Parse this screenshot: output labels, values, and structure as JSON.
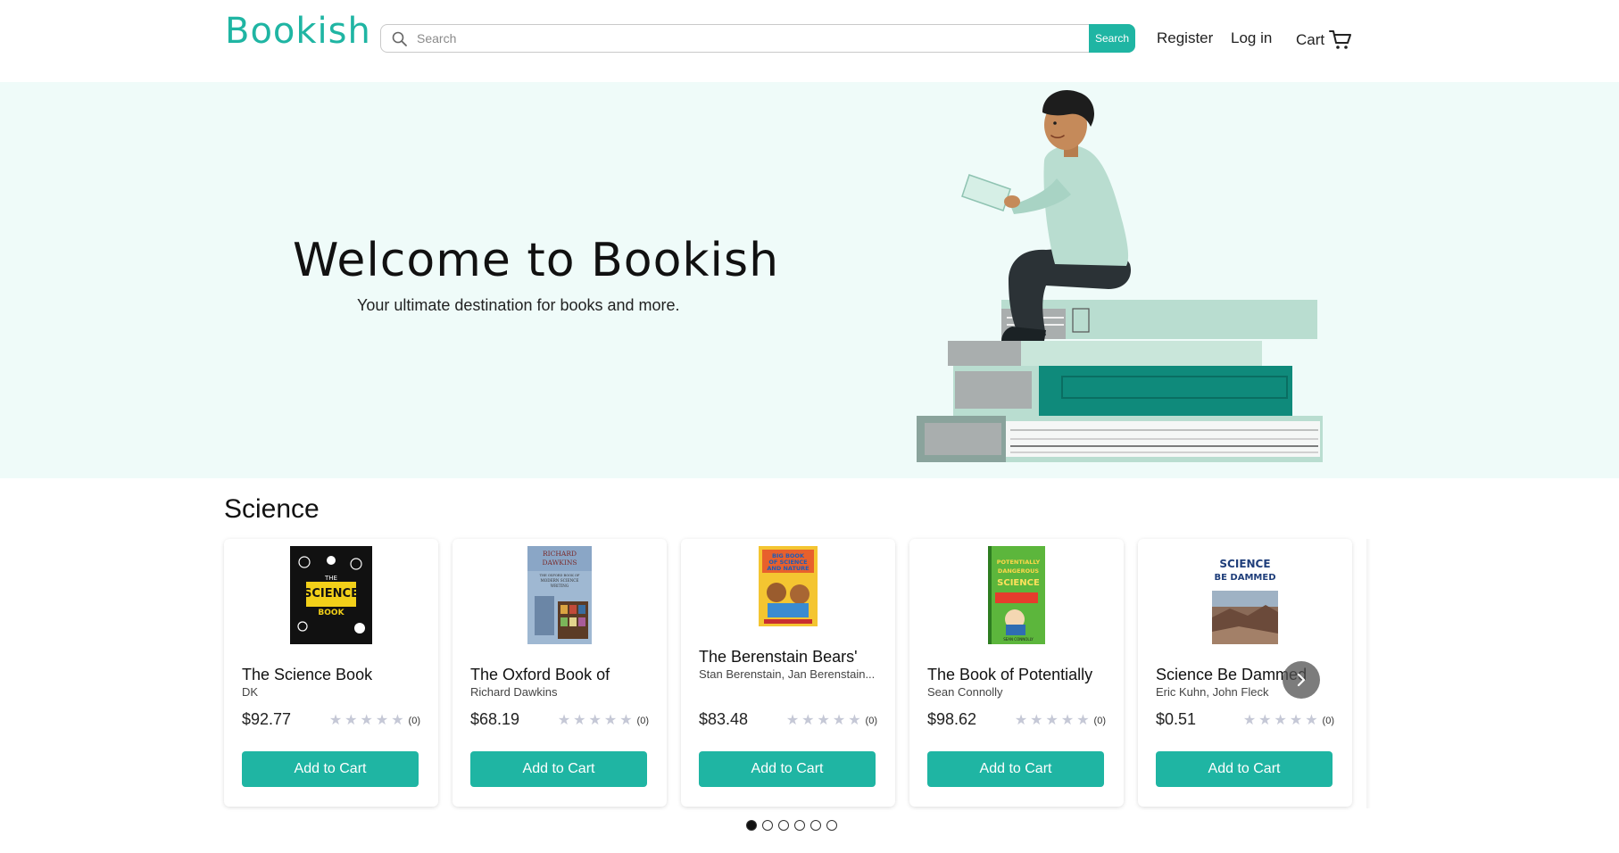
{
  "header": {
    "logo": "Bookish",
    "search_placeholder": "Search",
    "search_button": "Search",
    "register": "Register",
    "login": "Log in",
    "cart": "Cart"
  },
  "hero": {
    "title": "Welcome to Bookish",
    "subtitle": "Your ultimate destination for books and more."
  },
  "section": {
    "title": "Science"
  },
  "products": [
    {
      "title": "The Science Book",
      "author": "DK",
      "price": "$92.77",
      "rating_count": "(0)",
      "button": "Add to Cart"
    },
    {
      "title": "The Oxford Book of",
      "author": "Richard Dawkins",
      "price": "$68.19",
      "rating_count": "(0)",
      "button": "Add to Cart"
    },
    {
      "title": "The Berenstain Bears'",
      "author": "Stan Berenstain, Jan Berenstain...",
      "price": "$83.48",
      "rating_count": "(0)",
      "button": "Add to Cart"
    },
    {
      "title": "The Book of Potentially",
      "author": "Sean Connolly",
      "price": "$98.62",
      "rating_count": "(0)",
      "button": "Add to Cart"
    },
    {
      "title": "Science Be Dammed",
      "author": "Eric Kuhn, John Fleck",
      "price": "$0.51",
      "rating_count": "(0)",
      "button": "Add to Cart"
    }
  ],
  "covers": {
    "science_book": {
      "line1": "THE",
      "line2": "SCIENCE",
      "line3": "BOOK"
    },
    "oxford_book": {
      "line1": "RICHARD",
      "line2": "DAWKINS",
      "line3": "THE OXFORD BOOK OF",
      "line4": "MODERN SCIENCE",
      "line5": "WRITING"
    },
    "berenstain": {
      "line1": "BIG BOOK",
      "line2": "OF SCIENCE",
      "line3": "AND NATURE"
    },
    "potentially": {
      "line1": "POTENTIALLY",
      "line2": "DANGEROUS",
      "line3": "SCIENCE",
      "line4": "SEAN CONNOLLY"
    },
    "dammed": {
      "line1": "SCIENCE",
      "line2": "BE DAMMED"
    }
  },
  "carousel": {
    "pages": 6,
    "active_page": 1
  },
  "colors": {
    "accent": "#1fb5a3",
    "hero_bg": "#effbf9"
  }
}
